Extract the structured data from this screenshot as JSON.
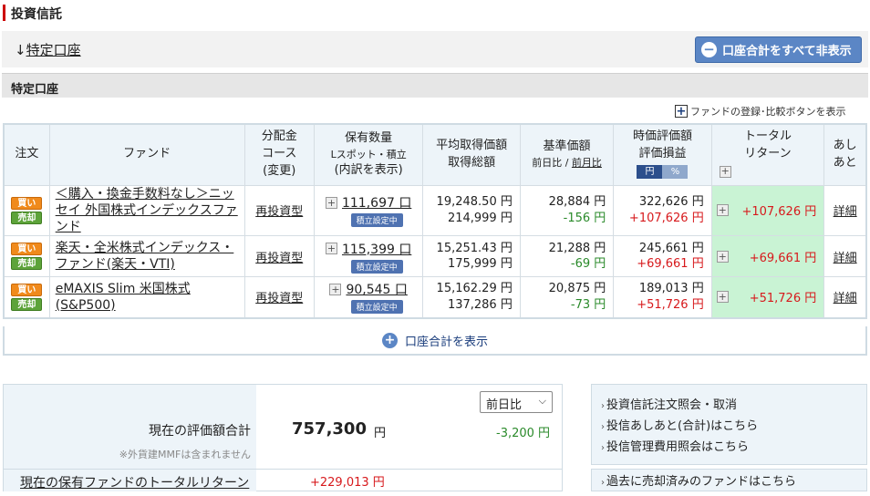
{
  "page": {
    "title": "投資信託",
    "account_link": "特定口座",
    "account_link_arrow": "↓",
    "hide_button": "口座合計をすべて非表示",
    "section_title": "特定口座",
    "fund_register_label": "ファンドの登録･比較ボタンを表示"
  },
  "table": {
    "headers": {
      "order": "注文",
      "fund": "ファンド",
      "dist_1": "分配金",
      "dist_2": "コース",
      "dist_3": "(変更)",
      "qty_1": "保有数量",
      "qty_2": "Lスポット・積立",
      "qty_3": "(内訳を表示)",
      "avg_1": "平均取得価額",
      "avg_2": "取得総額",
      "base_1": "基準価額",
      "base_2": "前日比",
      "base_3": "前月比",
      "val_1": "時価評価額",
      "val_2": "評価損益",
      "toggle_yen": "円",
      "toggle_pct": "%",
      "total_1": "トータル",
      "total_2": "リターン",
      "ashi_1": "あし",
      "ashi_2": "あと"
    },
    "buy_label": "買い",
    "sell_label": "売却",
    "tsumitate_label": "積立設定中",
    "rows": [
      {
        "fund_name": "＜購入・換金手数料なし＞ニッセイ 外国株式インデックスファンド",
        "dist_course": "再投資型",
        "quantity": "111,697 口",
        "avg_price": "19,248.50 円",
        "total_cost": "214,999 円",
        "base_price": "28,884 円",
        "base_change": "-156 円",
        "market_value": "322,626 円",
        "unrealized": "+107,626 円",
        "total_return": "+107,626 円",
        "detail": "詳細"
      },
      {
        "fund_name": "楽天・全米株式インデックス・ファンド(楽天・VTI)",
        "dist_course": "再投資型",
        "quantity": "115,399 口",
        "avg_price": "15,251.43 円",
        "total_cost": "175,999 円",
        "base_price": "21,288 円",
        "base_change": "-69 円",
        "market_value": "245,661 円",
        "unrealized": "+69,661 円",
        "total_return": "+69,661 円",
        "detail": "詳細"
      },
      {
        "fund_name": "eMAXIS Slim 米国株式(S&P500)",
        "dist_course": "再投資型",
        "quantity": "90,545 口",
        "avg_price": "15,162.29 円",
        "total_cost": "137,286 円",
        "base_price": "20,875 円",
        "base_change": "-73 円",
        "market_value": "189,013 円",
        "unrealized": "+51,726 円",
        "total_return": "+51,726 円",
        "detail": "詳細"
      }
    ],
    "show_total": "口座合計を表示"
  },
  "summary": {
    "label_main": "現在の評価額合計",
    "note": "※外貨建MMFは含まれません",
    "value": "757,300",
    "unit": "円",
    "select_value": "前日比",
    "diff": "-3,200 円",
    "return_label": "現在の保有ファンドのトータルリターン",
    "return_value": "+229,013 円"
  },
  "links": {
    "items": [
      "投資信託注文照会・取消",
      "投信あしあと(合計)はこちら",
      "投信管理費用照会はこちら"
    ],
    "past": "過去に売却済みのファンドはこちら"
  },
  "colors": {
    "accent_blue": "#5b86c5",
    "green": "#2a8a2a",
    "red": "#d7191c",
    "total_bg": "#c9f3d4"
  }
}
